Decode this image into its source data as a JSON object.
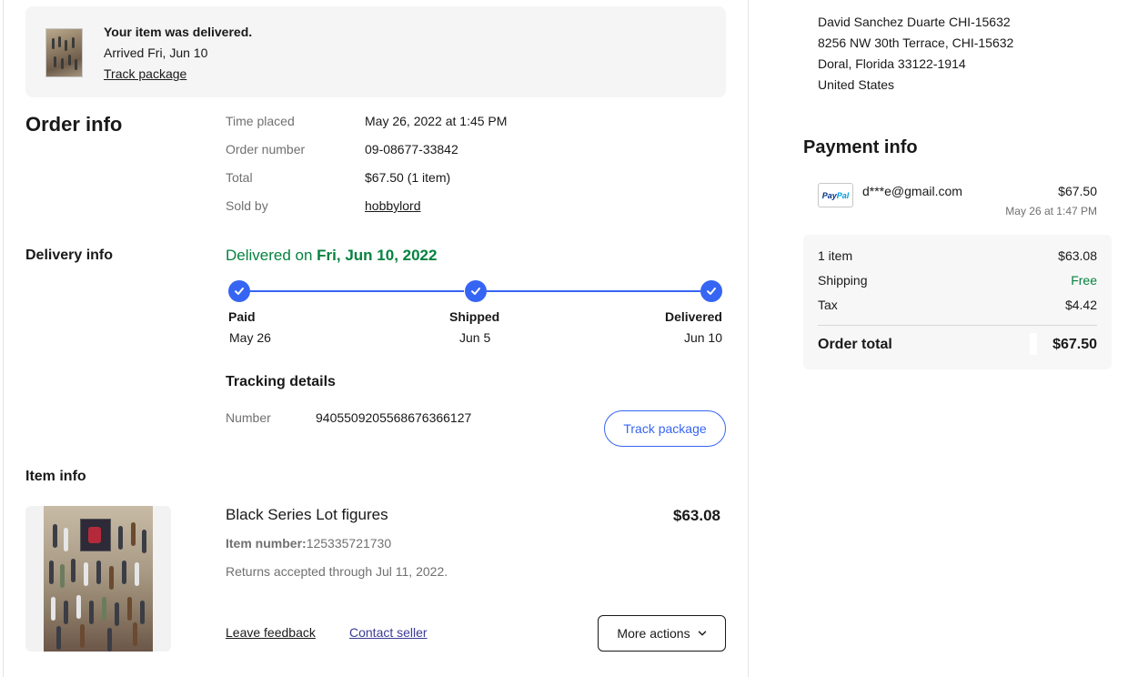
{
  "banner": {
    "title": "Your item was delivered.",
    "arrived": "Arrived Fri, Jun 10",
    "track_link": "Track package"
  },
  "order_info": {
    "heading": "Order info",
    "rows": [
      {
        "label": "Time placed",
        "value": "May 26, 2022 at 1:45 PM"
      },
      {
        "label": "Order number",
        "value": "09-08677-33842"
      },
      {
        "label": "Total",
        "value": "$67.50 (1 item)"
      },
      {
        "label": "Sold by",
        "value": "hobbylord"
      }
    ]
  },
  "delivery_info": {
    "heading": "Delivery info",
    "status_prefix": "Delivered on ",
    "status_date": "Fri, Jun 10, 2022",
    "steps": [
      {
        "label": "Paid",
        "date": "May 26"
      },
      {
        "label": "Shipped",
        "date": "Jun 5"
      },
      {
        "label": "Delivered",
        "date": "Jun 10"
      }
    ],
    "tracking_heading": "Tracking details",
    "tracking_label": "Number",
    "tracking_number": "9405509205568676366127",
    "track_button": "Track package"
  },
  "item_info": {
    "heading": "Item info",
    "title": "Black Series Lot  figures",
    "price": "$63.08",
    "item_number_label": "Item number:",
    "item_number": "125335721730",
    "returns": "Returns accepted through Jul 11, 2022.",
    "leave_feedback": "Leave feedback",
    "contact_seller": "Contact seller",
    "more_actions": "More actions"
  },
  "shipping_address": {
    "lines": [
      "David Sanchez Duarte CHI-15632",
      "8256 NW 30th Terrace, CHI-15632",
      "Doral, Florida 33122-1914",
      "United States"
    ]
  },
  "payment_info": {
    "heading": "Payment info",
    "method_icon": "paypal-logo",
    "method_logo_text_a": "Pay",
    "method_logo_text_b": "Pal",
    "email": "d***e@gmail.com",
    "amount": "$67.50",
    "date": "May 26 at 1:47 PM"
  },
  "summary": {
    "rows": [
      {
        "label": "1 item",
        "value": "$63.08"
      },
      {
        "label": "Shipping",
        "value": "Free"
      },
      {
        "label": "Tax",
        "value": "$4.42"
      }
    ],
    "total_label": "Order total",
    "total_value": "$67.50"
  },
  "colors": {
    "accent_blue": "#3665f3",
    "success_green": "#05823f",
    "text_secondary": "#707070"
  }
}
